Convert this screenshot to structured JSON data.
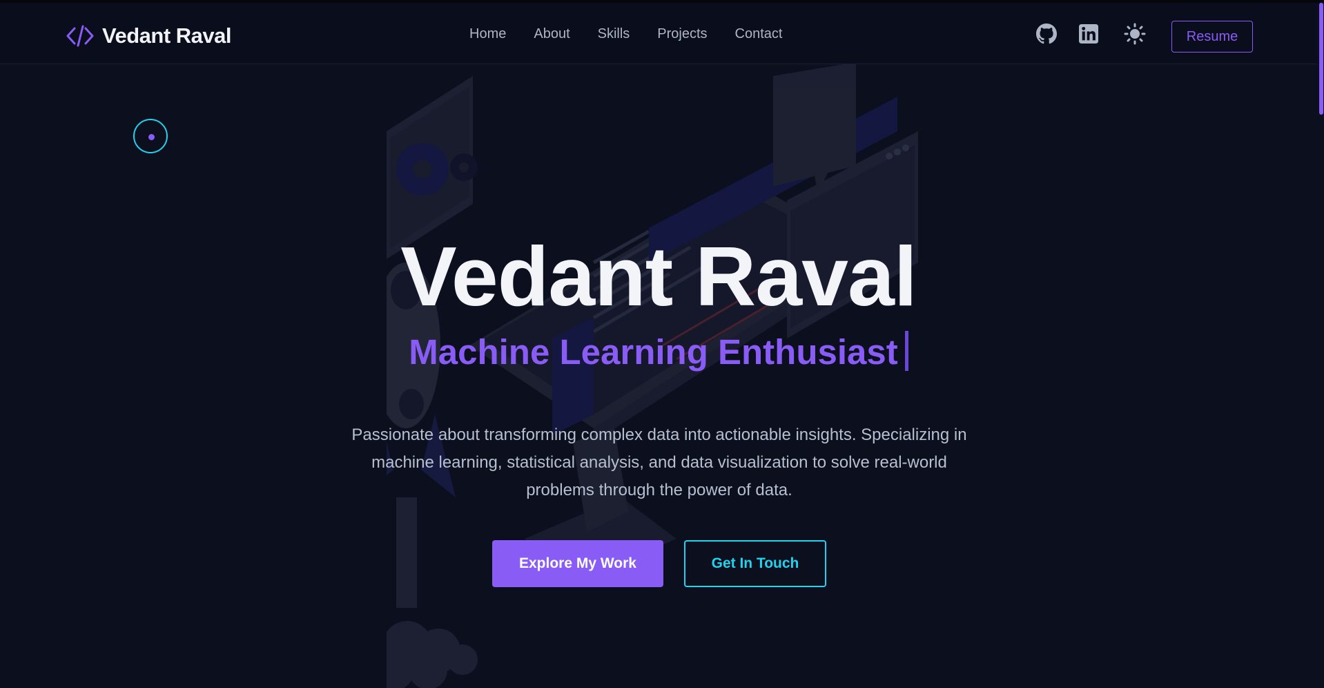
{
  "brand": {
    "name": "Vedant Raval",
    "logo_icon": "code-brackets-icon"
  },
  "nav": {
    "links": [
      {
        "label": "Home"
      },
      {
        "label": "About"
      },
      {
        "label": "Skills"
      },
      {
        "label": "Projects"
      },
      {
        "label": "Contact"
      }
    ],
    "icons": [
      "github-icon",
      "linkedin-icon",
      "sun-icon"
    ],
    "resume_label": "Resume"
  },
  "hero": {
    "title": "Vedant Raval",
    "subtitle": "Machine Learning Enthusiast",
    "description": "Passionate about transforming complex data into actionable insights. Specializing in machine learning, statistical analysis, and data visualization to solve real-world problems through the power of data.",
    "primary_button": "Explore My Work",
    "secondary_button": "Get In Touch"
  },
  "colors": {
    "background": "#0b0f1e",
    "accent_purple": "#8a5cf6",
    "accent_cyan": "#22d3ee",
    "text": "#f3f4f8",
    "muted_text": "#b8bfd0"
  }
}
